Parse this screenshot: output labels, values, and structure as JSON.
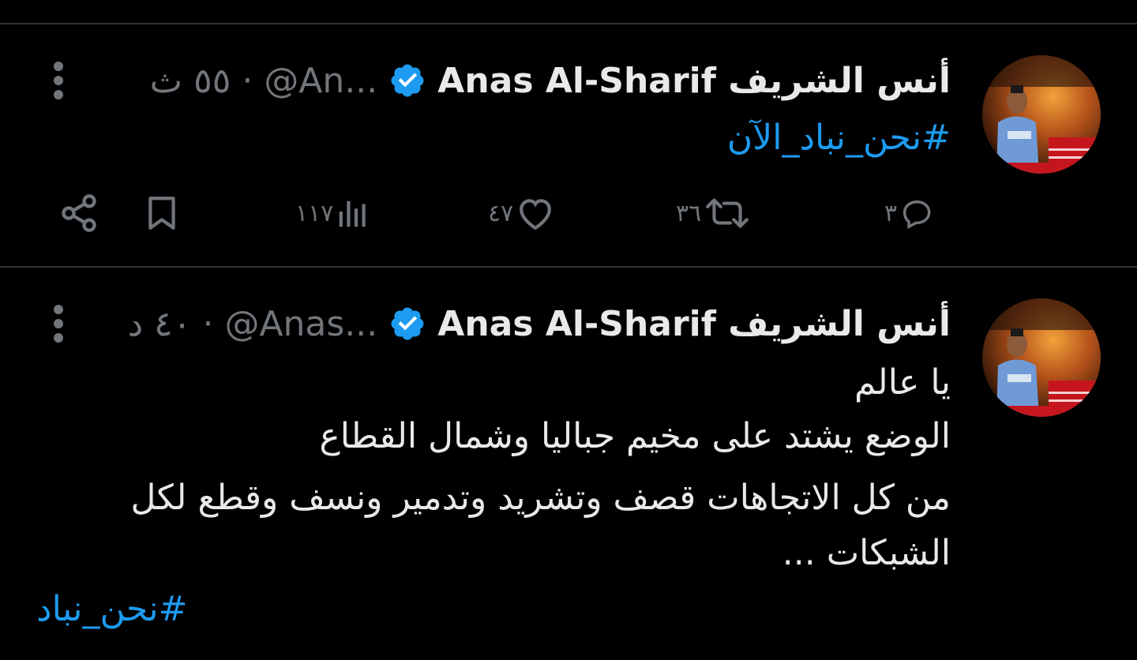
{
  "tweets": [
    {
      "display_name": "أنس الشريف Anas Al-Sharif",
      "handle": "@An...",
      "separator": "·",
      "time": "٥٥ ث",
      "text": "#نحن_نباد_الآن",
      "actions": {
        "replies": "٣",
        "retweets": "٣٦",
        "likes": "٤٧",
        "views": "١١٧"
      }
    },
    {
      "display_name": "أنس الشريف Anas Al-Sharif",
      "handle": "@Anas...",
      "separator": "·",
      "time": "٤٠ د",
      "lines": [
        "يا عالم",
        "الوضع يشتد على مخيم جباليا  وشمال القطاع",
        "من كل الاتجاهات قصف وتشريد وتدمير ونسف وقطع لكل",
        "الشبكات ..."
      ],
      "hashtag": "#نحن_نباد"
    }
  ],
  "icons": {
    "verified": "verified-badge-icon",
    "more": "more-options-icon",
    "reply": "reply-icon",
    "retweet": "retweet-icon",
    "like": "heart-icon",
    "views": "views-chart-icon",
    "bookmark": "bookmark-icon",
    "share": "share-icon"
  },
  "colors": {
    "background": "#000000",
    "text": "#e7e9ea",
    "muted": "#71767b",
    "accent": "#1d9bf0",
    "divider": "#2f3336"
  }
}
